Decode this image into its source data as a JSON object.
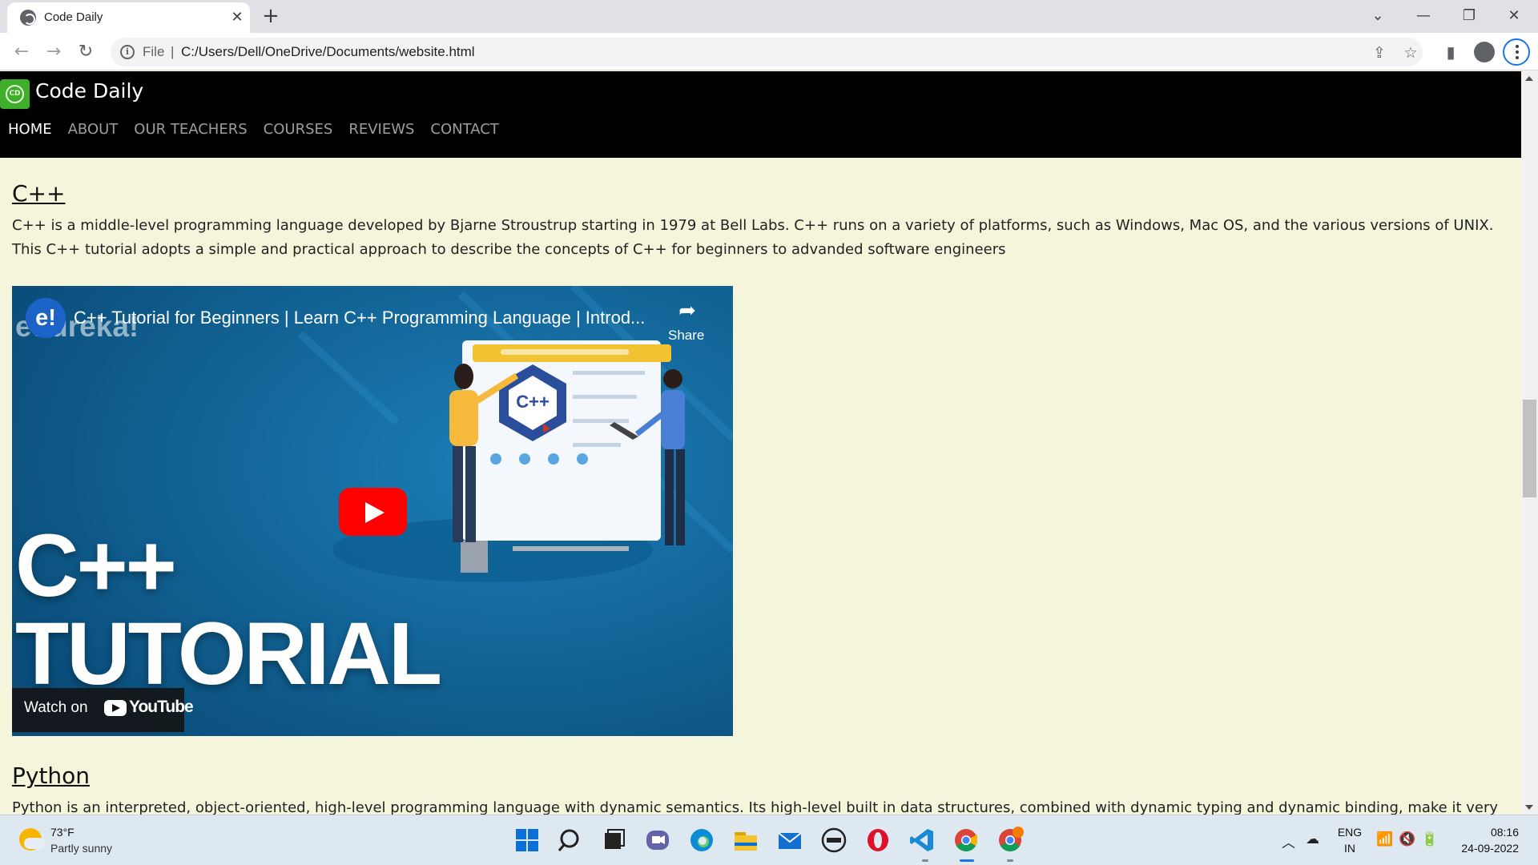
{
  "browser": {
    "tab_title": "Code Daily",
    "tab_close": "✕",
    "new_tab": "+",
    "scheme_label": "File",
    "separator": "|",
    "url": "C:/Users/Dell/OneDrive/Documents/website.html",
    "window_controls": {
      "dropdown": "⌄",
      "minimize": "—",
      "restore": "❐",
      "close": "✕"
    }
  },
  "site": {
    "logo_text": "CD",
    "brand": "Code Daily",
    "nav": [
      "HOME",
      "ABOUT",
      "OUR TEACHERS",
      "COURSES",
      "REVIEWS",
      "CONTACT"
    ],
    "active_nav": "HOME"
  },
  "sections": {
    "cpp": {
      "title": "C++",
      "text": "C++ is a middle-level programming language developed by Bjarne Stroustrup starting in 1979 at Bell Labs. C++ runs on a variety of platforms, such as Windows, Mac OS, and the various versions of UNIX. This C++ tutorial adopts a simple and practical approach to describe the concepts of C++ for beginners to advanded software engineers"
    },
    "python": {
      "title": "Python",
      "text": "Python is an interpreted, object-oriented, high-level programming language with dynamic semantics. Its high-level built in data structures, combined with dynamic typing and dynamic binding, make it very"
    }
  },
  "video": {
    "channel_logo": "e!",
    "watermark": "edureka!",
    "title": "C++ Tutorial for Beginners | Learn C++ Programming Language | Introd...",
    "share_label": "Share",
    "big_text_line1": "C++",
    "big_text_line2": "TUTORIAL",
    "graphic_label": "C++",
    "watch_on": "Watch on",
    "youtube": "YouTube"
  },
  "taskbar": {
    "weather_temp": "73°F",
    "weather_desc": "Partly sunny",
    "language": "ENG",
    "region": "IN",
    "time": "08:16",
    "date": "24-09-2022",
    "apps": [
      "start",
      "search",
      "task-view",
      "teams-chat",
      "edge",
      "file-explorer",
      "mail",
      "dell",
      "opera",
      "vscode",
      "chrome",
      "chrome-profile"
    ]
  },
  "colors": {
    "page_background": "#f5f5dc",
    "header_background": "#000000",
    "nav_inactive": "#9d9d9d",
    "logo_green": "#3fae2a",
    "youtube_red": "#ff0000"
  }
}
